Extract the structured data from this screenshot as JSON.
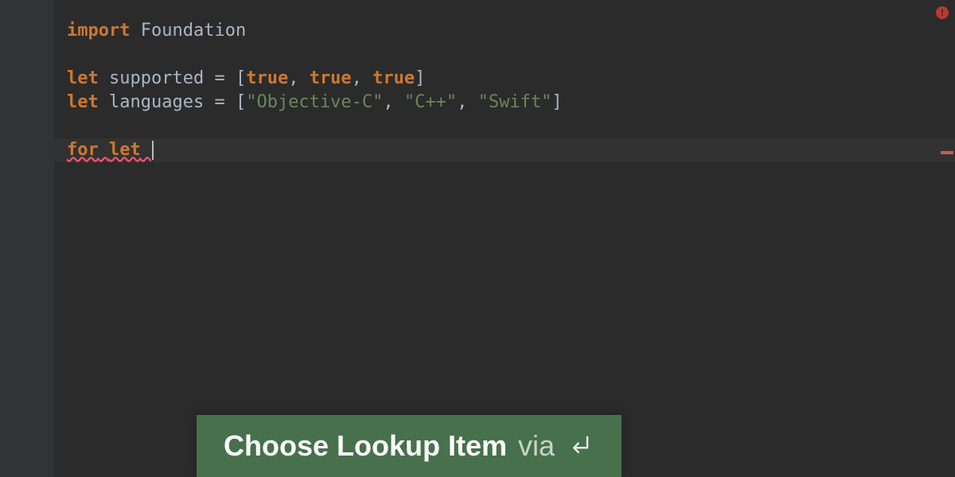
{
  "code": {
    "l1_import": "import",
    "l1_module": "Foundation",
    "l3_let": "let",
    "l3_name": "supported",
    "l3_eq": " = [",
    "l3_v1": "true",
    "l3_c1": ", ",
    "l3_v2": "true",
    "l3_c2": ", ",
    "l3_v3": "true",
    "l3_close": "]",
    "l4_let": "let",
    "l4_name": "languages",
    "l4_eq": " = [",
    "l4_s1": "\"Objective-C\"",
    "l4_c1": ", ",
    "l4_s2": "\"C++\"",
    "l4_c2": ", ",
    "l4_s3": "\"Swift\"",
    "l4_close": "]",
    "l6_for": "for",
    "l6_sp1": " ",
    "l6_let": "let",
    "l6_sp2": " "
  },
  "hint": {
    "strong": "Choose Lookup Item",
    "via": "via"
  }
}
